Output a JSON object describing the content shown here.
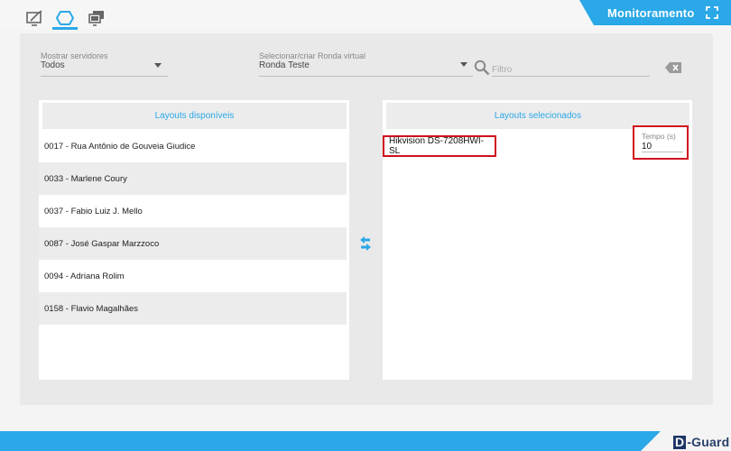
{
  "header": {
    "title": "Monitoramento",
    "tabs": [
      {
        "icon": "monitor-edit-icon",
        "active": false
      },
      {
        "icon": "hexagon-icon",
        "active": true
      },
      {
        "icon": "multi-screen-icon",
        "active": false
      }
    ],
    "expand_icon": "fullscreen-icon",
    "accent_color": "#2aa8e8"
  },
  "filters": {
    "servers": {
      "label": "Mostrar servidores",
      "value": "Todos"
    },
    "tour": {
      "label": "Selecionar/criar Ronda virtual",
      "value": "Ronda Teste"
    },
    "search": {
      "placeholder": "Filtro",
      "value": ""
    }
  },
  "available": {
    "header": "Layouts disponíveis",
    "items": [
      "0017 - Rua Antônio de Gouveia Giudice",
      "0033 - Marlene Coury",
      "0037 - Fabio Luiz J. Mello",
      "0087 - José Gaspar Marzzoco",
      "0094 - Adriana Rolim",
      "0158 - Flavio Magalhães"
    ]
  },
  "selected": {
    "header": "Layouts selecionados",
    "items": [
      {
        "name": "Hikvision DS-7208HWI-SL",
        "time_label": "Tempo (s)",
        "time_value": "10"
      }
    ]
  },
  "footer": {
    "brand_letter": "D",
    "brand_rest": "-Guard",
    "highlight_color": "#d0101e"
  }
}
